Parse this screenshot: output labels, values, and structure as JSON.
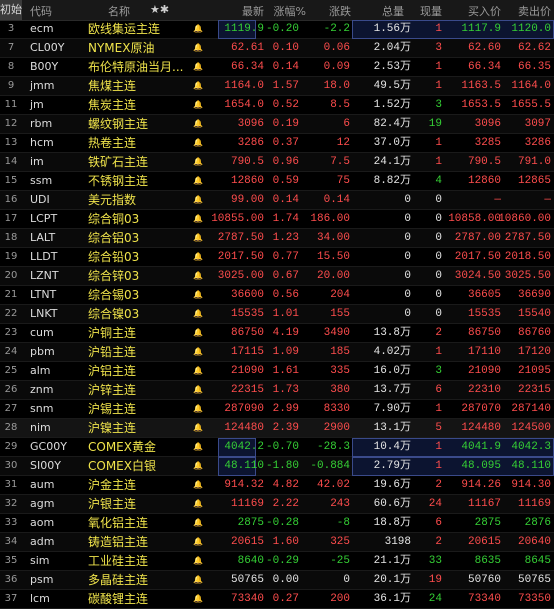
{
  "header": {
    "init_label": "初始",
    "code": "代码",
    "name": "名称",
    "last": "最新",
    "pct": "涨幅%",
    "chg": "涨跌",
    "vol": "总量",
    "cur": "现量",
    "buy": "买入价",
    "sell": "卖出价"
  },
  "colors": {
    "up": "#ff4d4d",
    "down": "#35d035",
    "name": "#f0e44b"
  },
  "rows": [
    {
      "idx": "3",
      "code": "ecm",
      "name": "欧线集运主连",
      "alert": false,
      "last": "1119.9",
      "pct": "-0.20",
      "chg": "-2.2",
      "vol": "1.56万",
      "cur": "1",
      "buy": "1117.9",
      "sell": "1120.0",
      "dir": "down",
      "box": true
    },
    {
      "idx": "7",
      "code": "CL00Y",
      "name": "NYMEX原油",
      "alert": false,
      "last": "62.61",
      "pct": "0.10",
      "chg": "0.06",
      "vol": "2.04万",
      "cur": "3",
      "buy": "62.60",
      "sell": "62.62",
      "dir": "up"
    },
    {
      "idx": "8",
      "code": "B00Y",
      "name": "布伦特原油当月...",
      "alert": false,
      "last": "66.34",
      "pct": "0.14",
      "chg": "0.09",
      "vol": "2.53万",
      "cur": "1",
      "buy": "66.34",
      "sell": "66.35",
      "dir": "up"
    },
    {
      "idx": "9",
      "code": "jmm",
      "name": "焦煤主连",
      "alert": false,
      "last": "1164.0",
      "pct": "1.57",
      "chg": "18.0",
      "vol": "49.5万",
      "cur": "1",
      "buy": "1163.5",
      "sell": "1164.0",
      "dir": "up"
    },
    {
      "idx": "11",
      "code": "jm",
      "name": "焦炭主连",
      "alert": false,
      "last": "1654.0",
      "pct": "0.52",
      "chg": "8.5",
      "vol": "1.52万",
      "cur": "3",
      "buy": "1653.5",
      "sell": "1655.5",
      "dir": "up",
      "curdir": "down"
    },
    {
      "idx": "12",
      "code": "rbm",
      "name": "螺纹钢主连",
      "alert": false,
      "last": "3096",
      "pct": "0.19",
      "chg": "6",
      "vol": "82.4万",
      "cur": "19",
      "buy": "3096",
      "sell": "3097",
      "dir": "up",
      "curdir": "down"
    },
    {
      "idx": "13",
      "code": "hcm",
      "name": "热卷主连",
      "alert": false,
      "last": "3286",
      "pct": "0.37",
      "chg": "12",
      "vol": "37.0万",
      "cur": "1",
      "buy": "3285",
      "sell": "3286",
      "dir": "up"
    },
    {
      "idx": "14",
      "code": "im",
      "name": "铁矿石主连",
      "alert": false,
      "last": "790.5",
      "pct": "0.96",
      "chg": "7.5",
      "vol": "24.1万",
      "cur": "1",
      "buy": "790.5",
      "sell": "791.0",
      "dir": "up"
    },
    {
      "idx": "15",
      "code": "ssm",
      "name": "不锈钢主连",
      "alert": false,
      "last": "12860",
      "pct": "0.59",
      "chg": "75",
      "vol": "8.82万",
      "cur": "4",
      "buy": "12860",
      "sell": "12865",
      "dir": "up",
      "curdir": "down"
    },
    {
      "idx": "16",
      "code": "UDI",
      "name": "美元指数",
      "alert": false,
      "last": "99.00",
      "pct": "0.14",
      "chg": "0.14",
      "vol": "0",
      "cur": "0",
      "buy": "—",
      "sell": "—",
      "dir": "up",
      "volw": true
    },
    {
      "idx": "17",
      "code": "LCPT",
      "name": "综合铜03",
      "alert": false,
      "last": "10855.00",
      "pct": "1.74",
      "chg": "186.00",
      "vol": "0",
      "cur": "0",
      "buy": "10858.00",
      "sell": "10860.00",
      "dir": "up",
      "volw": true
    },
    {
      "idx": "18",
      "code": "LALT",
      "name": "综合铝03",
      "alert": false,
      "last": "2787.50",
      "pct": "1.23",
      "chg": "34.00",
      "vol": "0",
      "cur": "0",
      "buy": "2787.00",
      "sell": "2787.50",
      "dir": "up",
      "volw": true
    },
    {
      "idx": "19",
      "code": "LLDT",
      "name": "综合铅03",
      "alert": false,
      "last": "2017.50",
      "pct": "0.77",
      "chg": "15.50",
      "vol": "0",
      "cur": "0",
      "buy": "2017.50",
      "sell": "2018.50",
      "dir": "up",
      "volw": true
    },
    {
      "idx": "20",
      "code": "LZNT",
      "name": "综合锌03",
      "alert": false,
      "last": "3025.00",
      "pct": "0.67",
      "chg": "20.00",
      "vol": "0",
      "cur": "0",
      "buy": "3024.50",
      "sell": "3025.50",
      "dir": "up",
      "volw": true
    },
    {
      "idx": "21",
      "code": "LTNT",
      "name": "综合锡03",
      "alert": false,
      "last": "36600",
      "pct": "0.56",
      "chg": "204",
      "vol": "0",
      "cur": "0",
      "buy": "36605",
      "sell": "36690",
      "dir": "up",
      "volw": true
    },
    {
      "idx": "22",
      "code": "LNKT",
      "name": "综合镍03",
      "alert": false,
      "last": "15535",
      "pct": "1.01",
      "chg": "155",
      "vol": "0",
      "cur": "0",
      "buy": "15535",
      "sell": "15540",
      "dir": "up",
      "volw": true
    },
    {
      "idx": "23",
      "code": "cum",
      "name": "沪铜主连",
      "alert": true,
      "last": "86750",
      "pct": "4.19",
      "chg": "3490",
      "vol": "13.8万",
      "cur": "2",
      "buy": "86750",
      "sell": "86760",
      "dir": "up"
    },
    {
      "idx": "24",
      "code": "pbm",
      "name": "沪铅主连",
      "alert": false,
      "last": "17115",
      "pct": "1.09",
      "chg": "185",
      "vol": "4.02万",
      "cur": "1",
      "buy": "17110",
      "sell": "17120",
      "dir": "up"
    },
    {
      "idx": "25",
      "code": "alm",
      "name": "沪铝主连",
      "alert": false,
      "last": "21090",
      "pct": "1.61",
      "chg": "335",
      "vol": "16.0万",
      "cur": "3",
      "buy": "21090",
      "sell": "21095",
      "dir": "up",
      "curdir": "down"
    },
    {
      "idx": "26",
      "code": "znm",
      "name": "沪锌主连",
      "alert": false,
      "last": "22315",
      "pct": "1.73",
      "chg": "380",
      "vol": "13.7万",
      "cur": "6",
      "buy": "22310",
      "sell": "22315",
      "dir": "up"
    },
    {
      "idx": "27",
      "code": "snm",
      "name": "沪锡主连",
      "alert": false,
      "last": "287090",
      "pct": "2.99",
      "chg": "8330",
      "vol": "7.90万",
      "cur": "1",
      "buy": "287070",
      "sell": "287140",
      "dir": "up"
    },
    {
      "idx": "28",
      "code": "nim",
      "name": "沪镍主连",
      "alert": false,
      "last": "124480",
      "pct": "2.39",
      "chg": "2900",
      "vol": "13.1万",
      "cur": "5",
      "buy": "124480",
      "sell": "124500",
      "dir": "up",
      "sel": true
    },
    {
      "idx": "29",
      "code": "GC00Y",
      "name": "COMEX黄金",
      "alert": false,
      "last": "4042.2",
      "pct": "-0.70",
      "chg": "-28.3",
      "vol": "10.4万",
      "cur": "1",
      "buy": "4041.9",
      "sell": "4042.3",
      "dir": "down",
      "box": true
    },
    {
      "idx": "30",
      "code": "SI00Y",
      "name": "COMEX白银",
      "alert": false,
      "last": "48.110",
      "pct": "-1.80",
      "chg": "-0.884",
      "vol": "2.79万",
      "cur": "1",
      "buy": "48.095",
      "sell": "48.110",
      "dir": "down",
      "box": true
    },
    {
      "idx": "31",
      "code": "aum",
      "name": "沪金主连",
      "alert": true,
      "last": "914.32",
      "pct": "4.82",
      "chg": "42.02",
      "vol": "19.6万",
      "cur": "2",
      "buy": "914.26",
      "sell": "914.30",
      "dir": "up"
    },
    {
      "idx": "32",
      "code": "agm",
      "name": "沪银主连",
      "alert": false,
      "last": "11169",
      "pct": "2.22",
      "chg": "243",
      "vol": "60.6万",
      "cur": "24",
      "buy": "11167",
      "sell": "11169",
      "dir": "up"
    },
    {
      "idx": "33",
      "code": "aom",
      "name": "氧化铝主连",
      "alert": false,
      "last": "2875",
      "pct": "-0.28",
      "chg": "-8",
      "vol": "18.8万",
      "cur": "6",
      "buy": "2875",
      "sell": "2876",
      "dir": "down"
    },
    {
      "idx": "34",
      "code": "adm",
      "name": "铸造铝主连",
      "alert": false,
      "last": "20615",
      "pct": "1.60",
      "chg": "325",
      "vol": "3198",
      "cur": "2",
      "buy": "20615",
      "sell": "20640",
      "dir": "up"
    },
    {
      "idx": "35",
      "code": "sim",
      "name": "工业硅主连",
      "alert": false,
      "last": "8640",
      "pct": "-0.29",
      "chg": "-25",
      "vol": "21.1万",
      "cur": "33",
      "buy": "8635",
      "sell": "8645",
      "dir": "down",
      "curdir": "down"
    },
    {
      "idx": "36",
      "code": "psm",
      "name": "多晶硅主连",
      "alert": false,
      "last": "50765",
      "pct": "0.00",
      "chg": "0",
      "vol": "20.1万",
      "cur": "19",
      "buy": "50760",
      "sell": "50765",
      "dir": "flat"
    },
    {
      "idx": "37",
      "code": "lcm",
      "name": "碳酸锂主连",
      "alert": false,
      "last": "73340",
      "pct": "0.27",
      "chg": "200",
      "vol": "36.1万",
      "cur": "24",
      "buy": "73340",
      "sell": "73350",
      "dir": "up",
      "curdir": "down"
    }
  ]
}
